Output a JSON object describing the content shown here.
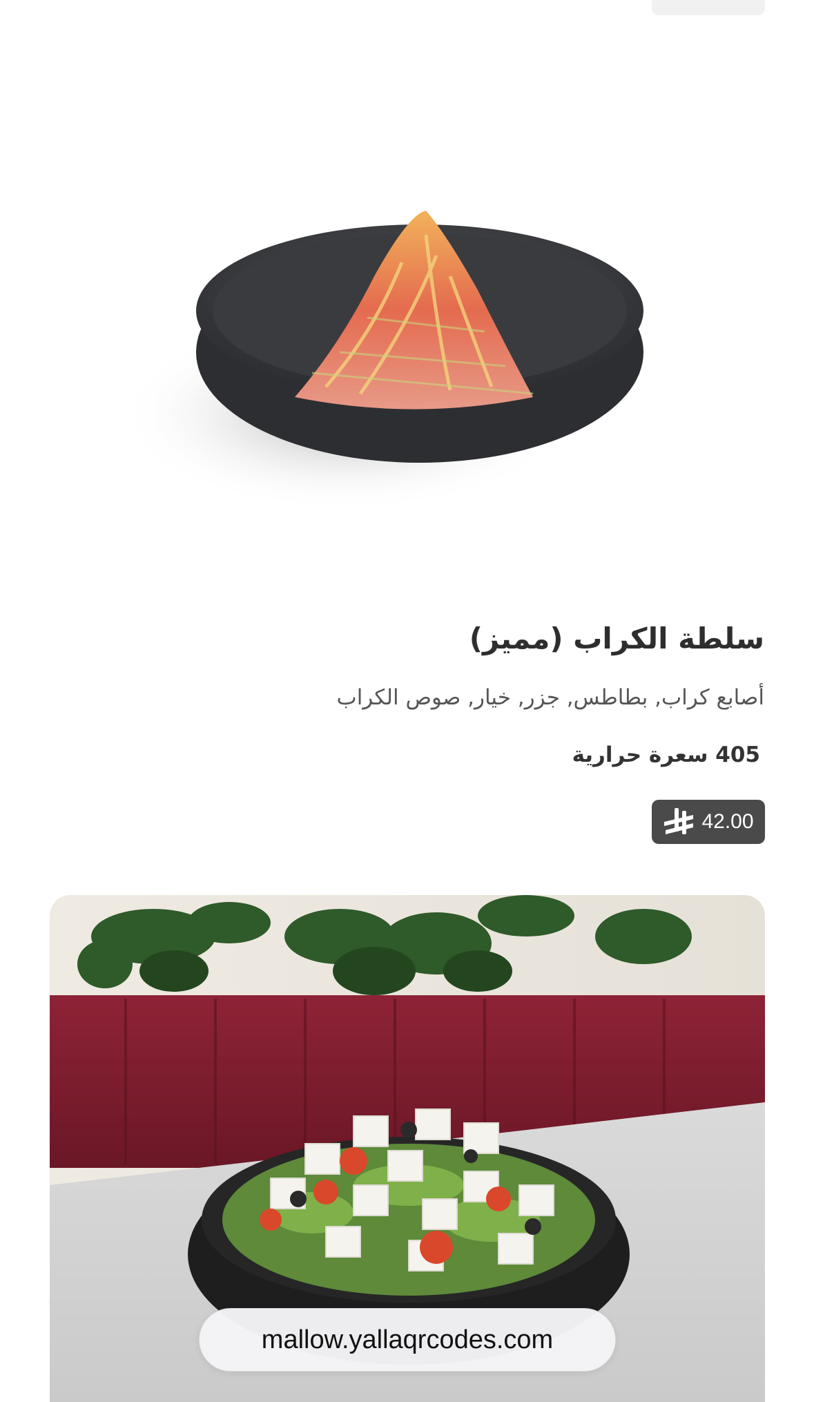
{
  "item": {
    "title": "سلطة الكراب (مميز)",
    "description": "أصابع كراب, بطاطس, جزر, خيار, صوص الكراب",
    "calories": "405 سعرة حرارية",
    "price": "42.00",
    "currency_icon": "saudi-riyal-icon"
  },
  "browser": {
    "url": "mallow.yallaqrcodes.com"
  },
  "colors": {
    "price_badge_bg": "#4a4a4a",
    "title_text": "#2e2e2e",
    "sofa": "#7c1e2e"
  }
}
